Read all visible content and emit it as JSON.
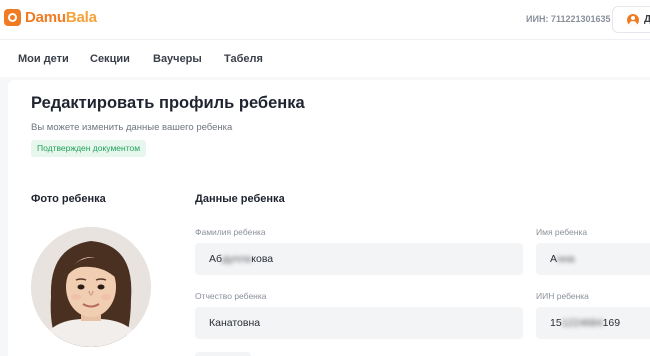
{
  "header": {
    "logo": {
      "part1": "Damu",
      "part2": "Bala"
    },
    "iin": "ИИН: 711221301635",
    "user_initial": "Д"
  },
  "nav": {
    "items": [
      {
        "label": "Мои дети"
      },
      {
        "label": "Секции"
      },
      {
        "label": "Ваучеры"
      },
      {
        "label": "Табеля"
      }
    ]
  },
  "page": {
    "title": "Редактировать профиль ребенка",
    "subtitle": "Вы можете изменить данные вашего ребенка",
    "badge": "Подтвержден документом"
  },
  "sections": {
    "photo_title": "Фото ребенка",
    "data_title": "Данные ребенка"
  },
  "fields": {
    "last_name": {
      "label": "Фамилия ребенка",
      "value_start": "Аб",
      "value_hidden": "дулла",
      "value_end": "кова"
    },
    "first_name": {
      "label": "Имя ребенка",
      "value_start": "А",
      "value_hidden": "нна",
      "value_end": ""
    },
    "patronymic": {
      "label": "Отчество ребенка",
      "value": "Канатовна"
    },
    "iin": {
      "label": "ИИН ребенка",
      "value_start": "15",
      "value_hidden": "1224684",
      "value_end": "169"
    }
  },
  "colors": {
    "brand": "#f07b22",
    "badge_bg": "#e7f7ee",
    "badge_text": "#23a25b",
    "field_bg": "#f3f4f6"
  }
}
